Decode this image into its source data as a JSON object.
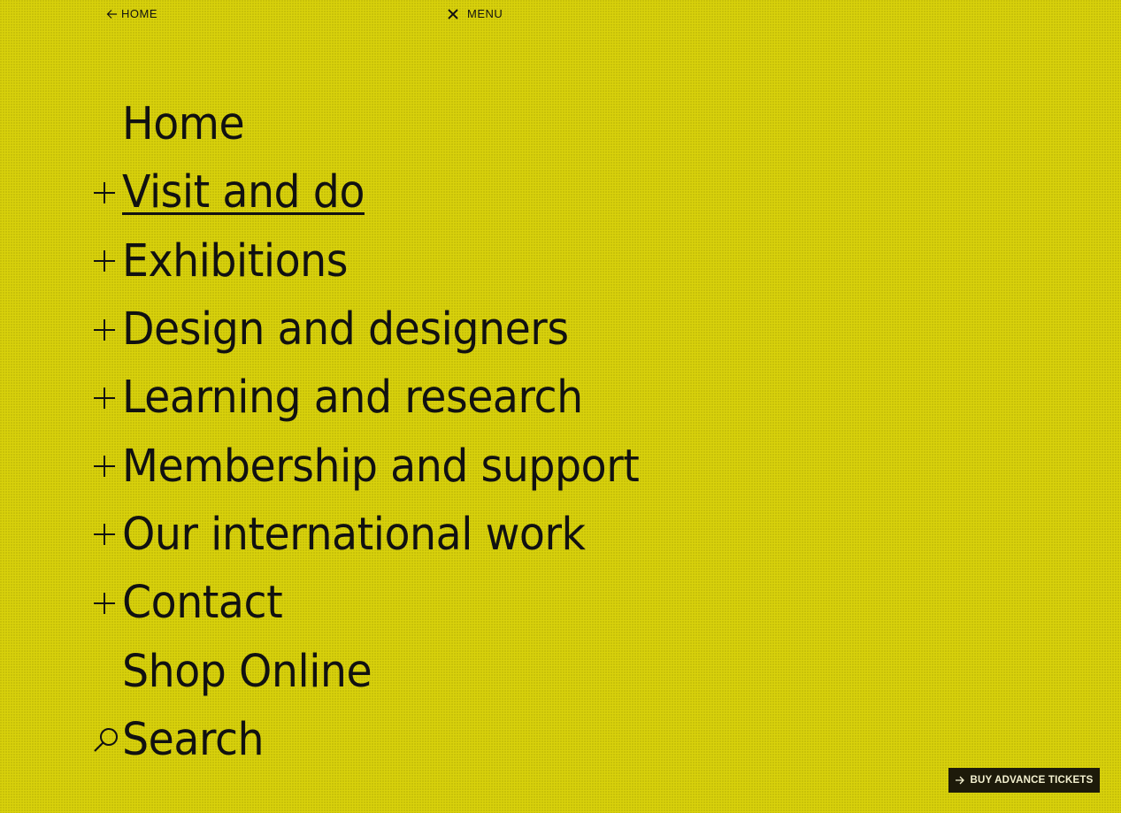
{
  "topbar": {
    "home_label": "HOME",
    "menu_label": "MENU"
  },
  "nav": {
    "items": [
      {
        "label": "Home",
        "icon": "none"
      },
      {
        "label": "Visit and do",
        "icon": "plus-icon",
        "active": true
      },
      {
        "label": "Exhibitions",
        "icon": "plus-icon"
      },
      {
        "label": "Design and designers",
        "icon": "plus-icon"
      },
      {
        "label": "Learning and research",
        "icon": "plus-icon"
      },
      {
        "label": "Membership and support",
        "icon": "plus-icon"
      },
      {
        "label": "Our international work",
        "icon": "plus-icon"
      },
      {
        "label": "Contact",
        "icon": "plus-icon"
      },
      {
        "label": "Shop Online",
        "icon": "none"
      },
      {
        "label": "Search",
        "icon": "search-icon"
      }
    ]
  },
  "cta": {
    "tickets_label": "BUY ADVANCE TICKETS"
  },
  "colors": {
    "background": "#d9d20b",
    "text": "#111111",
    "button_bg": "#1d1a0a",
    "button_text": "#f4f1d0"
  }
}
